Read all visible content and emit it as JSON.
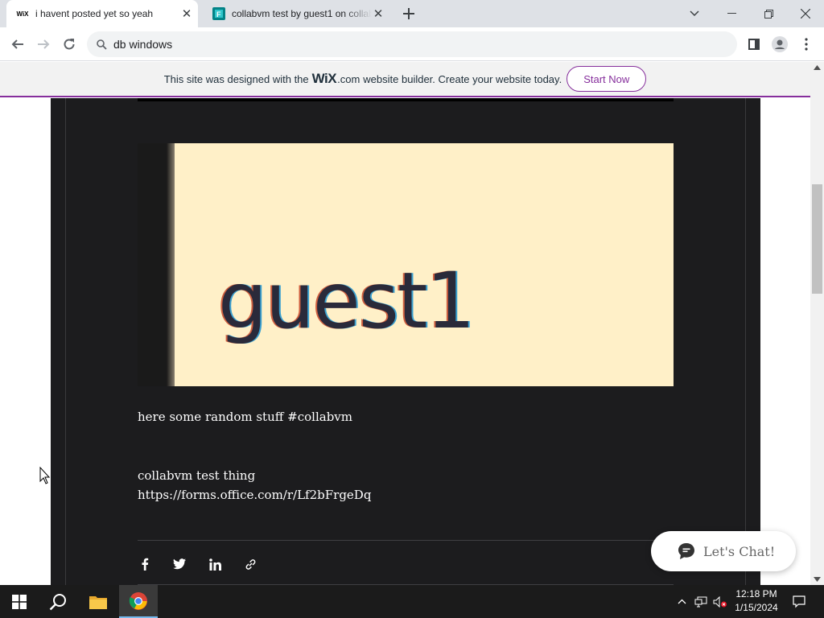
{
  "browser": {
    "tabs": [
      {
        "favicon": "wix-favicon",
        "favicon_text": "WiX",
        "title": "i havent posted yet so yeah",
        "active": true
      },
      {
        "favicon": "forms-favicon",
        "favicon_text": "F",
        "title": "collabvm test by guest1 on collab",
        "active": false
      }
    ],
    "omnibox": {
      "query": "db windows"
    }
  },
  "wix_banner": {
    "text_before": "This site was designed with the",
    "logo": "WiX",
    "logo_suffix": ".com",
    "text_after": "website builder. Create your website today.",
    "button": "Start Now",
    "accent_color": "#862f9c"
  },
  "post": {
    "image_text": "guest1",
    "body_line1": "here some random stuff #collabvm",
    "body_line2": "collabvm test thing",
    "link": "https://forms.office.com/r/Lf2bFrgeDq",
    "share_icons": [
      "facebook-icon",
      "twitter-icon",
      "linkedin-icon",
      "link-icon"
    ]
  },
  "chat_widget": {
    "label": "Let's Chat!"
  },
  "taskbar": {
    "time": "12:18 PM",
    "date": "1/15/2024"
  }
}
